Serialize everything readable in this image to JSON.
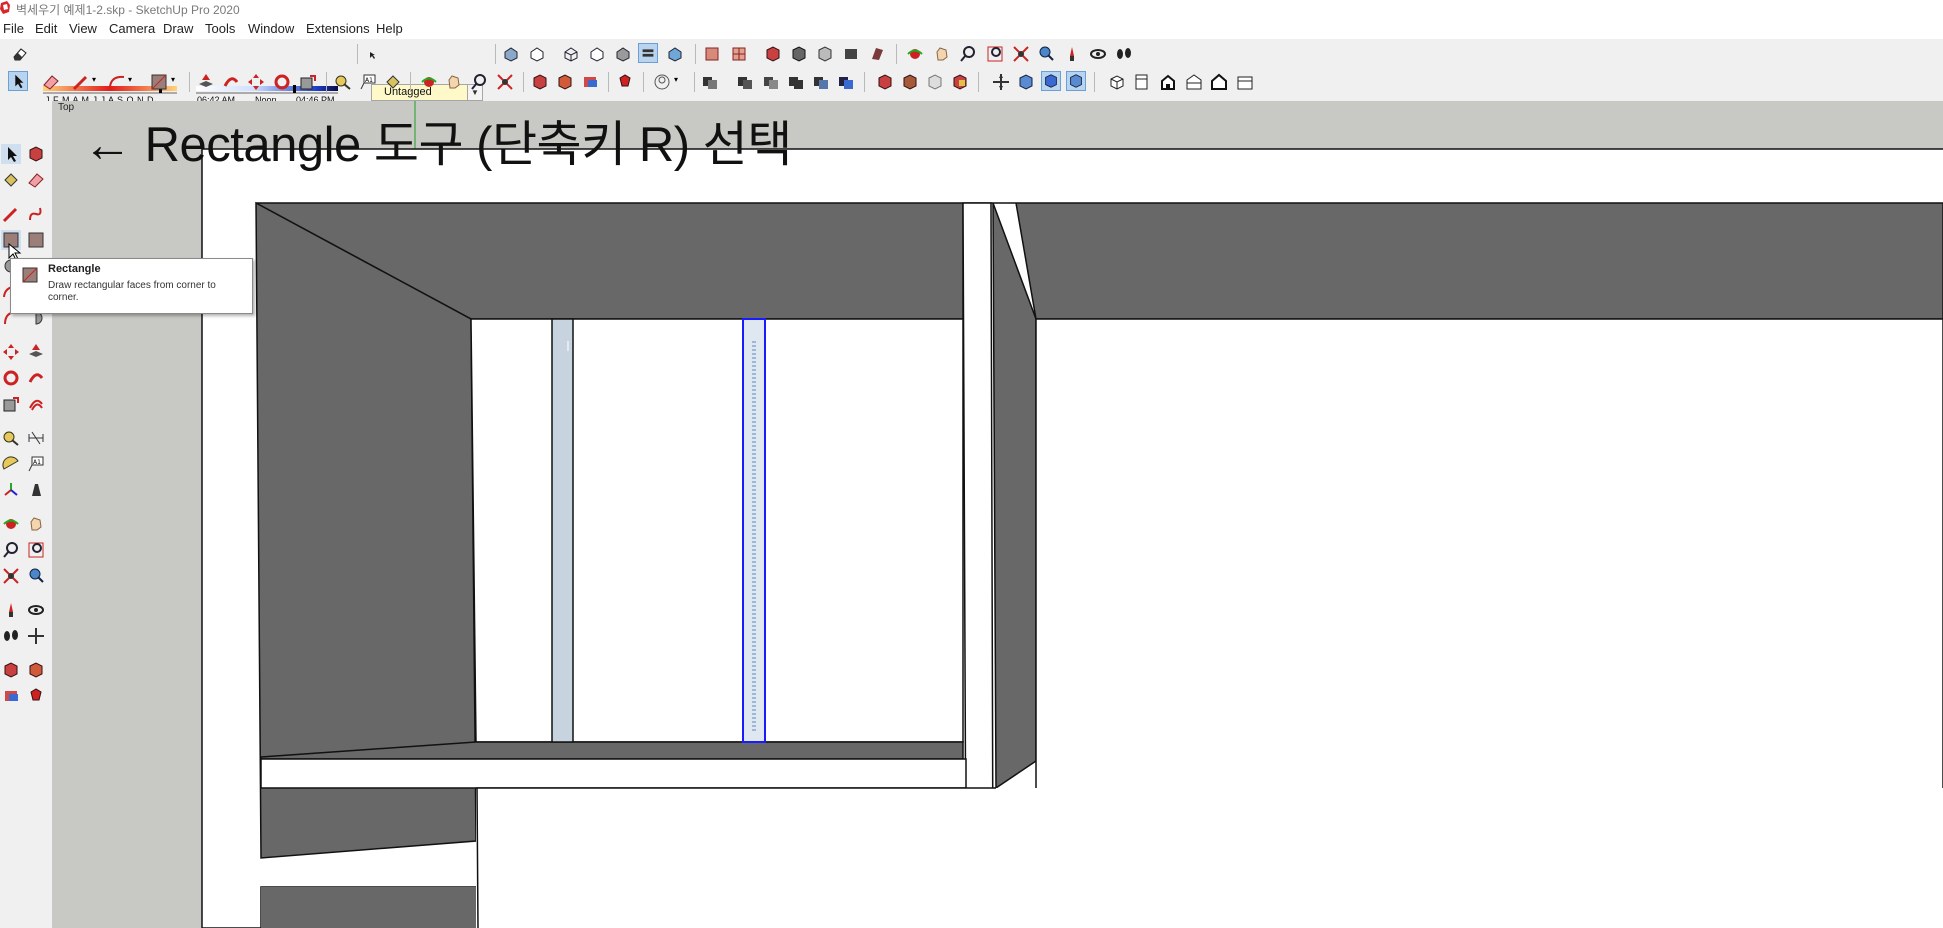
{
  "window": {
    "title": "벽세우기 예제1-2.skp - SketchUp Pro 2020"
  },
  "menu": {
    "items": [
      "File",
      "Edit",
      "View",
      "Camera",
      "Draw",
      "Tools",
      "Window",
      "Extensions",
      "Help"
    ]
  },
  "shadows": {
    "months": "J F M A M J J A S O N D",
    "time_start": "06:42 AM",
    "time_mid": "Noon",
    "time_end": "04:46 PM"
  },
  "tags": {
    "current": "Untagged"
  },
  "viewport": {
    "scene_label": "Top"
  },
  "annotation": {
    "text": "← Rectangle 도구 (단축키 R) 선택"
  },
  "tooltip": {
    "title": "Rectangle",
    "description": "Draw rectangular faces from corner to corner."
  },
  "colors": {
    "wall_dark": "#686868",
    "face_white": "#ffffff",
    "background": "#c8c8c4",
    "selection_blue": "#1a1aff",
    "face_bluegray": "#c7d4e0",
    "tag_yellow": "#fff8c8"
  },
  "icons": [
    "eraser-icon",
    "select-icon",
    "paint-bucket-icon",
    "line-icon",
    "arc-icon",
    "rectangle-icon",
    "push-pull-icon",
    "move-icon",
    "rotate-icon",
    "scale-icon",
    "offset-icon",
    "tape-measure-icon",
    "text-icon",
    "protractor-icon",
    "axes-icon",
    "orbit-icon",
    "pan-icon",
    "zoom-icon",
    "zoom-window-icon",
    "zoom-extents-icon",
    "position-camera-icon",
    "look-around-icon",
    "walk-icon",
    "section-plane-icon",
    "iso-view-icon",
    "top-view-icon",
    "front-view-icon",
    "right-view-icon",
    "back-view-icon",
    "left-view-icon",
    "xray-icon",
    "wireframe-icon",
    "hidden-line-icon",
    "shaded-icon",
    "shaded-textures-icon",
    "monochrome-icon",
    "warehouse-icon",
    "extension-icon",
    "house-icon",
    "component-icon"
  ]
}
